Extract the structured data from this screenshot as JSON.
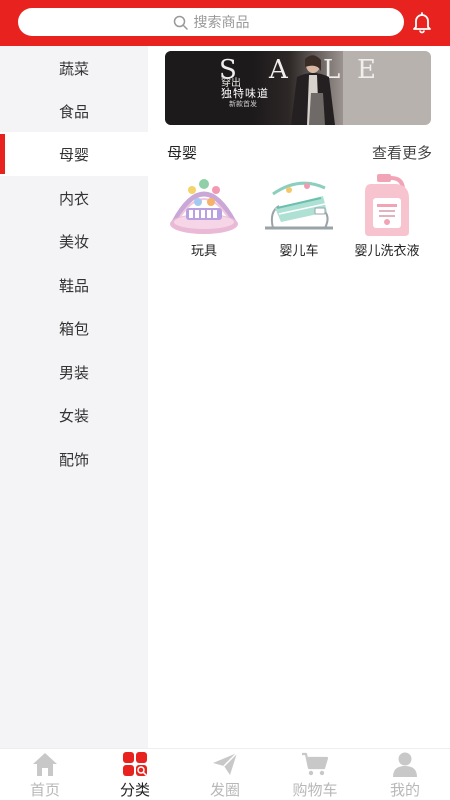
{
  "header": {
    "search_placeholder": "搜索商品",
    "search_icon": "search-icon",
    "bell_icon": "bell-icon",
    "accent_color": "#e8231f"
  },
  "sidebar": {
    "items": [
      {
        "label": "蔬菜",
        "active": false
      },
      {
        "label": "食品",
        "active": false
      },
      {
        "label": "母婴",
        "active": true
      },
      {
        "label": "内衣",
        "active": false
      },
      {
        "label": "美妆",
        "active": false
      },
      {
        "label": "鞋品",
        "active": false
      },
      {
        "label": "箱包",
        "active": false
      },
      {
        "label": "男装",
        "active": false
      },
      {
        "label": "女装",
        "active": false
      },
      {
        "label": "配饰",
        "active": false
      }
    ]
  },
  "banner": {
    "sale_letters": [
      "S",
      "A",
      "L",
      "E"
    ],
    "line1": "穿出",
    "line2": "独特味道",
    "line3": "新款首发"
  },
  "section": {
    "title": "母婴",
    "more": "查看更多",
    "products": [
      {
        "name": "玩具",
        "icon": "baby-play-gym-image"
      },
      {
        "name": "婴儿车",
        "icon": "baby-bouncer-image"
      },
      {
        "name": "婴儿洗衣液",
        "icon": "baby-detergent-bottle-image"
      }
    ]
  },
  "bottom_nav": {
    "items": [
      {
        "label": "首页",
        "icon": "home-icon",
        "active": false
      },
      {
        "label": "分类",
        "icon": "category-icon",
        "active": true
      },
      {
        "label": "发圈",
        "icon": "send-icon",
        "active": false
      },
      {
        "label": "购物车",
        "icon": "cart-icon",
        "active": false
      },
      {
        "label": "我的",
        "icon": "user-icon",
        "active": false
      }
    ]
  }
}
